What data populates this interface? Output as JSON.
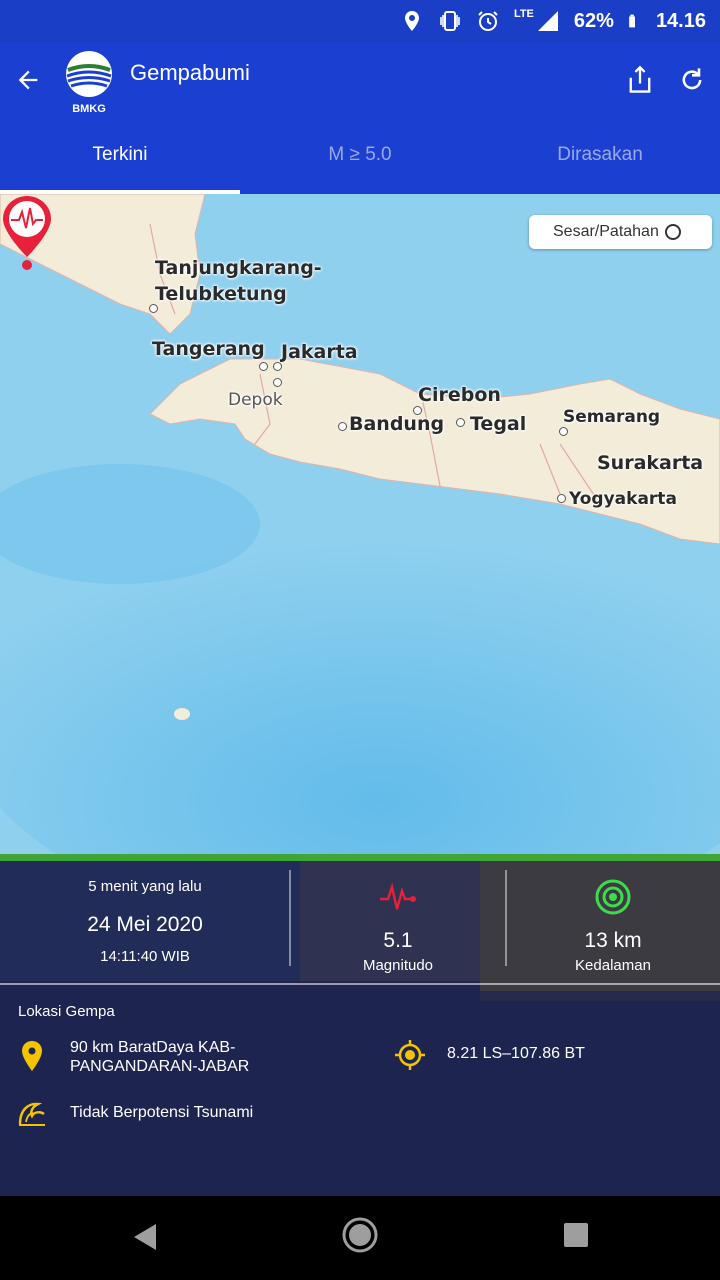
{
  "status_bar": {
    "network": "LTE",
    "battery": "62%",
    "time": "14.16",
    "icons": [
      "location-icon",
      "vibrate-icon",
      "alarm-icon",
      "signal-icon",
      "battery-icon"
    ]
  },
  "app_bar": {
    "title": "Gempabumi",
    "logo_text": "BMKG",
    "icons": [
      "back-arrow-icon",
      "share-icon",
      "refresh-icon"
    ]
  },
  "tabs": [
    {
      "label": "Terkini",
      "active": true
    },
    {
      "label": "M ≥ 5.0",
      "active": false
    },
    {
      "label": "Dirasakan",
      "active": false
    }
  ],
  "map": {
    "fault_toggle_label": "Sesar/Patahan",
    "cities": {
      "tanjungkarang_1": "Tanjungkarang-",
      "tanjungkarang_2": "Telubketung",
      "tangerang": "Tangerang",
      "jakarta": "Jakarta",
      "depok": "Depok",
      "cirebon": "Cirebon",
      "bandung": "Bandung",
      "tegal": "Tegal",
      "semarang": "Semarang",
      "surakarta": "Surakarta",
      "yogyakarta": "Yogyakarta"
    },
    "colors": {
      "sea": "#8fd0ef",
      "land": "#f2ecd9",
      "marker": "#e8213a"
    }
  },
  "quake": {
    "ago": "5 menit yang lalu",
    "date": "24 Mei 2020",
    "time": "14:11:40 WIB",
    "magnitude": "5.1",
    "magnitude_label": "Magnitudo",
    "depth": "13 km",
    "depth_label": "Kedalaman",
    "location_title": "Lokasi Gempa",
    "location": "90 km BaratDaya KAB-PANGANDARAN-JABAR",
    "coordinates": "8.21 LS–107.86 BT",
    "tsunami": "Tidak Berpotensi Tsunami",
    "colors": {
      "panel": "#202650",
      "accent_green": "#3fa535",
      "icon_yellow": "#f5c400",
      "mag_red": "#e8213a",
      "depth_green": "#3ddc4a"
    }
  }
}
